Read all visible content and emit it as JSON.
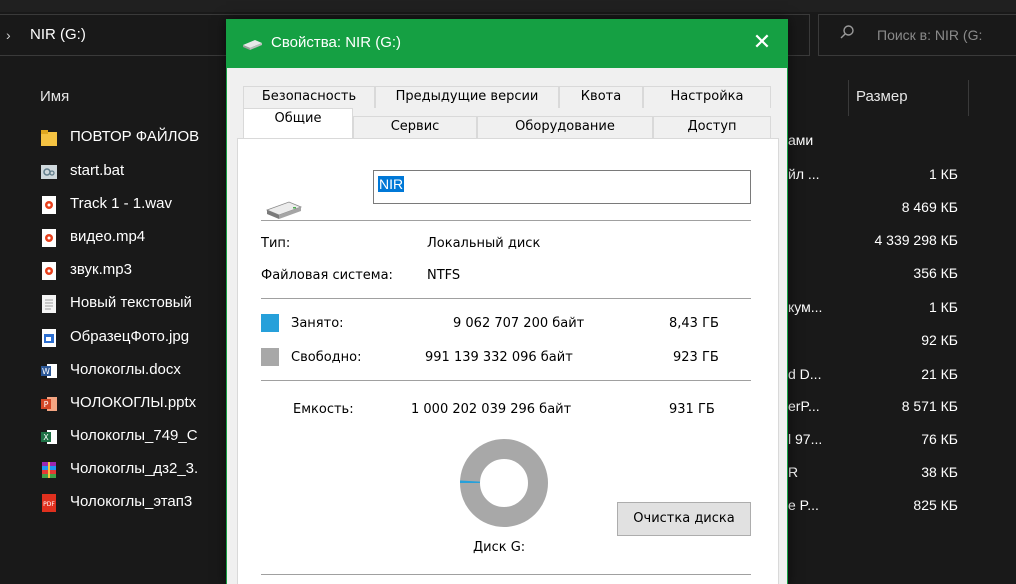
{
  "explorer": {
    "address": "NIR (G:)",
    "search_placeholder": "Поиск в: NIR (G:",
    "columns": {
      "name": "Имя",
      "size": "Размер"
    },
    "type_header_partial": "ами",
    "files": [
      {
        "name": "ПОВТОР ФАЙЛОВ",
        "icon": "folder-icon",
        "type_partial": "",
        "size": ""
      },
      {
        "name": "start.bat",
        "icon": "batch-file-icon",
        "type_partial": "йл ...",
        "size": "1 КБ"
      },
      {
        "name": "Track 1 - 1.wav",
        "icon": "audio-file-icon",
        "type_partial": "",
        "size": "8 469 КБ"
      },
      {
        "name": "видео.mp4",
        "icon": "video-file-icon",
        "type_partial": "",
        "size": "4 339 298 КБ"
      },
      {
        "name": "звук.mp3",
        "icon": "audio-file-icon",
        "type_partial": "",
        "size": "356 КБ"
      },
      {
        "name": "Новый текстовый",
        "icon": "text-file-icon",
        "type_partial": "кум...",
        "size": "1 КБ"
      },
      {
        "name": "ОбразецФото.jpg",
        "icon": "image-file-icon",
        "type_partial": "",
        "size": "92 КБ"
      },
      {
        "name": "Чолокоглы.docx",
        "icon": "word-file-icon",
        "type_partial": "d D...",
        "size": "21 КБ"
      },
      {
        "name": "ЧОЛОКОГЛЫ.pptx",
        "icon": "powerpoint-file-icon",
        "type_partial": "erP...",
        "size": "8 571 КБ"
      },
      {
        "name": "Чолокоглы_749_С",
        "icon": "excel-file-icon",
        "type_partial": "l 97...",
        "size": "76 КБ"
      },
      {
        "name": "Чолокоглы_дз2_3.",
        "icon": "archive-file-icon",
        "type_partial": "R",
        "size": "38 КБ"
      },
      {
        "name": "Чолокоглы_этап3",
        "icon": "pdf-file-icon",
        "type_partial": "e P...",
        "size": "825 КБ"
      }
    ]
  },
  "dialog": {
    "title": "Свойства: NIR (G:)",
    "close_glyph": "✕",
    "tabs_row1": [
      "Безопасность",
      "Предыдущие версии",
      "Квота",
      "Настройка"
    ],
    "tabs_row2": [
      "Общие",
      "Сервис",
      "Оборудование",
      "Доступ"
    ],
    "active_tab": "Общие",
    "drive_name": "NIR",
    "type_label": "Тип:",
    "type_value": "Локальный диск",
    "fs_label": "Файловая система:",
    "fs_value": "NTFS",
    "used_label": "Занято:",
    "used_bytes": "9 062 707 200 байт",
    "used_short": "8,43 ГБ",
    "free_label": "Свободно:",
    "free_bytes": "991 139 332 096 байт",
    "free_short": "923 ГБ",
    "capacity_label": "Емкость:",
    "capacity_bytes": "1 000 202 039 296 байт",
    "capacity_short": "931 ГБ",
    "disk_label": "Диск G:",
    "cleanup_button": "Очистка диска",
    "used_fraction": 0.00906,
    "colors": {
      "used": "#26a0da",
      "free": "#a8a8a8",
      "title_bar": "#15a043"
    }
  }
}
